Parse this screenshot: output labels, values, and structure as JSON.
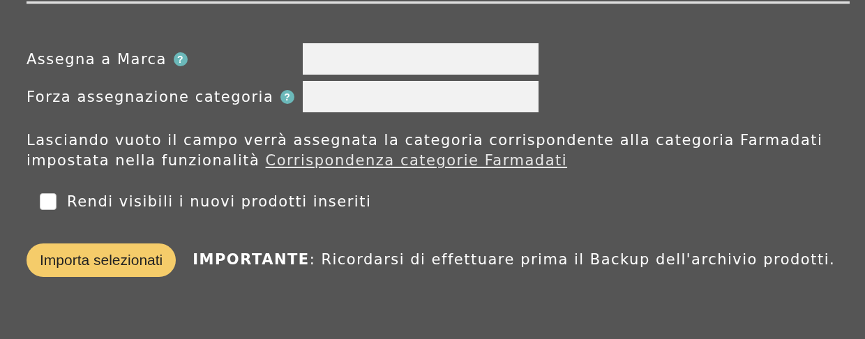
{
  "fields": [
    {
      "label": "Assegna a Marca",
      "help": "?"
    },
    {
      "label": "Forza assegnazione categoria",
      "help": "?"
    }
  ],
  "note": {
    "text": "Lasciando vuoto il campo verrà assegnata la categoria corrispondente alla categoria Farmadati impostata nella funzionalità",
    "link": "Corrispondenza categorie Farmadati"
  },
  "checkbox": {
    "label": "Rendi visibili i nuovi prodotti inseriti",
    "checked": false
  },
  "import_button": "Importa selezionati",
  "warning": "**IMPORTANTE**: Ricordarsi di effettuare prima il Backup dell'archivio prodotti."
}
